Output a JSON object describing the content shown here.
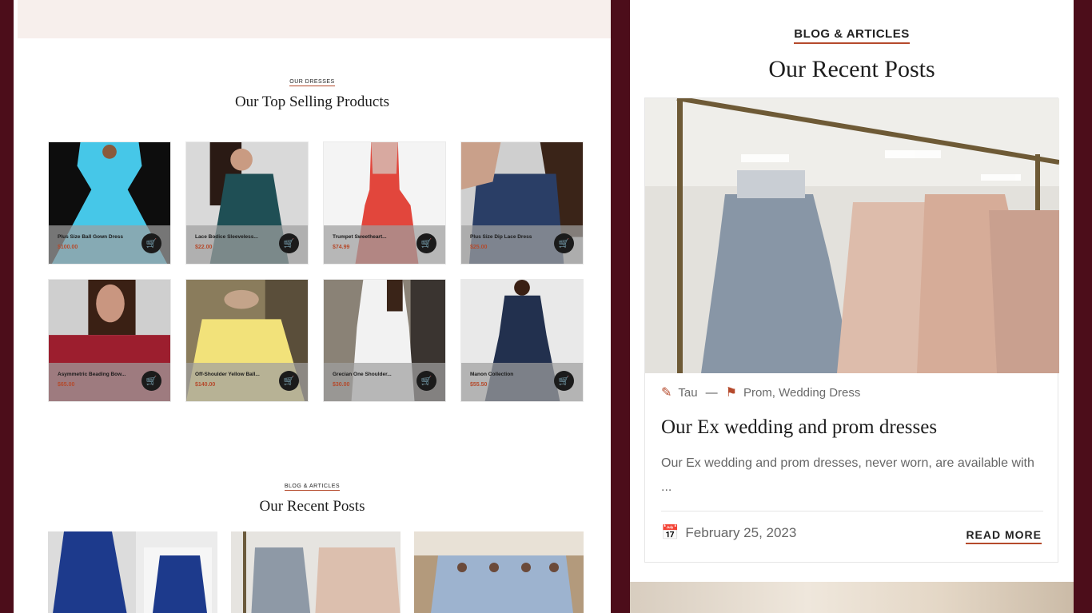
{
  "left": {
    "products_section": {
      "eyebrow": "OUR DRESSES",
      "title": "Our Top Selling Products",
      "products": [
        {
          "name": "Plus Size Ball Gown Dress",
          "price": "$100.00",
          "bg": [
            "#0d0d0d",
            "#46c7e8"
          ]
        },
        {
          "name": "Lace Bodice Sleeveless...",
          "price": "$22.00",
          "bg": [
            "#d9d9d9",
            "#1f4f55"
          ]
        },
        {
          "name": "Trumpet Sweetheart...",
          "price": "$74.99",
          "bg": [
            "#f4f4f4",
            "#e2463c"
          ]
        },
        {
          "name": "Plus Size Dip Lace Dress",
          "price": "$25.00",
          "bg": [
            "#cfcfcf",
            "#2a3e66"
          ]
        },
        {
          "name": "Asymmetric Beading Bow...",
          "price": "$65.00",
          "bg": [
            "#cfcfcf",
            "#9c1e2e"
          ]
        },
        {
          "name": "Off-Shoulder Yellow Ball...",
          "price": "$140.00",
          "bg": [
            "#8a7c5c",
            "#f2e27a"
          ]
        },
        {
          "name": "Grecian One Shoulder...",
          "price": "$30.00",
          "bg": [
            "#8a8276",
            "#f2f2f2"
          ]
        },
        {
          "name": "Manon Collection",
          "price": "$55.50",
          "bg": [
            "#e9e9e9",
            "#22304e"
          ]
        }
      ]
    },
    "blog_section": {
      "eyebrow": "BLOG & ARTICLES",
      "title": "Our Recent Posts"
    }
  },
  "right": {
    "eyebrow": "BLOG & ARTICLES",
    "title": "Our Recent Posts",
    "post": {
      "author": "Tau",
      "categories": "Prom, Wedding Dress",
      "title": "Our Ex wedding and prom dresses",
      "excerpt": "Our Ex wedding and prom dresses, never worn, are available with ...",
      "date": "February 25, 2023",
      "read_more": "READ MORE"
    }
  },
  "icons": {
    "basket": "basket-icon",
    "author": "user-edit-icon",
    "tag": "tag-icon",
    "calendar": "calendar-icon"
  },
  "colors": {
    "background": "#4c0d1a",
    "accent": "#b54a2c",
    "hero_tint": "#f7efec"
  }
}
